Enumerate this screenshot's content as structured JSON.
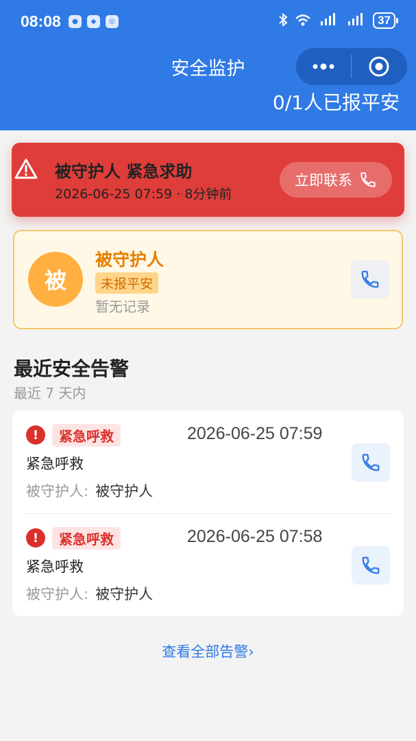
{
  "status_bar": {
    "time": "08:08",
    "battery": "37"
  },
  "header": {
    "title": "安全监护",
    "safe_count": "0/1人已报平安"
  },
  "alert_banner": {
    "title": "被守护人 紧急求助",
    "time": "2026-06-25 07:59 · 8分钟前",
    "contact_label": "立即联系"
  },
  "person": {
    "avatar_char": "被",
    "name": "被守护人",
    "status": "未报平安",
    "record": "暂无记录"
  },
  "alerts_section": {
    "title": "最近安全告警",
    "subtitle": "最近 7 天内",
    "person_label": "被守护人:",
    "items": [
      {
        "type": "紧急呼救",
        "time": "2026-06-25 07:59",
        "desc": "紧急呼救",
        "person": "被守护人"
      },
      {
        "type": "紧急呼救",
        "time": "2026-06-25 07:58",
        "desc": "紧急呼救",
        "person": "被守护人"
      }
    ],
    "view_all": "查看全部告警›"
  },
  "colors": {
    "header": "#2f7ae5",
    "alert_red": "#df3d3a",
    "warning_orange": "#e67e00"
  }
}
